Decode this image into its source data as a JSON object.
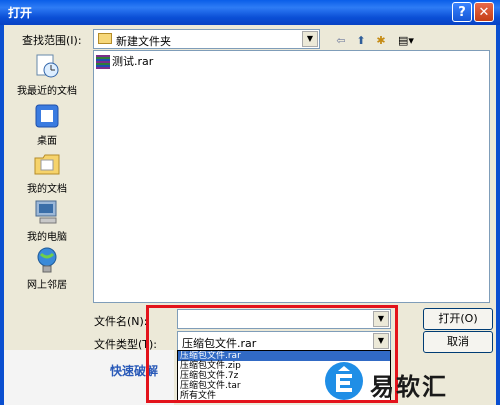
{
  "window": {
    "title": "打开",
    "help_label": "?",
    "close_label": "✕"
  },
  "lookin": {
    "label": "查找范围(I):",
    "value": "新建文件夹"
  },
  "toolbar": {
    "back": "⇦",
    "up": "⬆",
    "new_folder": "✱",
    "views": "▤▾"
  },
  "places": [
    {
      "label": "我最近的文档",
      "icon": "recent-documents-icon"
    },
    {
      "label": "桌面",
      "icon": "desktop-icon"
    },
    {
      "label": "我的文档",
      "icon": "my-documents-icon"
    },
    {
      "label": "我的电脑",
      "icon": "my-computer-icon"
    },
    {
      "label": "网上邻居",
      "icon": "network-places-icon"
    }
  ],
  "files": [
    {
      "name": "测试.rar",
      "icon": "rar-archive-icon"
    }
  ],
  "filename": {
    "label": "文件名(N):",
    "value": ""
  },
  "filetype": {
    "label": "文件类型(T):",
    "value": "压缩包文件.rar",
    "options": [
      "压缩包文件.rar",
      "压缩包文件.zip",
      "压缩包文件.7z",
      "压缩包文件.tar",
      "所有文件"
    ]
  },
  "buttons": {
    "open": "打开(O)",
    "cancel": "取消"
  },
  "background": {
    "quick_text": "快速破解"
  },
  "watermark": {
    "text": "易软汇"
  },
  "colors": {
    "titlebar": "#0a5ee8",
    "highlight": "#e3131b",
    "selection": "#316ac5"
  }
}
